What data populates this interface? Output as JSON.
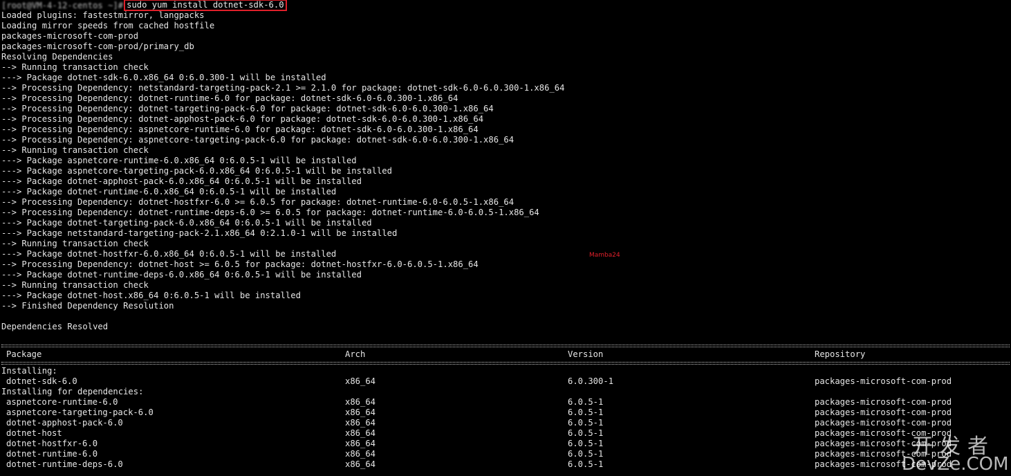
{
  "prompt": {
    "user_host": "[root@VM-4-12-centos ~]#",
    "command": "sudo yum install dotnet-sdk-6.0"
  },
  "output_lines": [
    "Loaded plugins: fastestmirror, langpacks",
    "Loading mirror speeds from cached hostfile",
    "packages-microsoft-com-prod",
    "packages-microsoft-com-prod/primary_db",
    "Resolving Dependencies",
    "--> Running transaction check",
    "---> Package dotnet-sdk-6.0.x86_64 0:6.0.300-1 will be installed",
    "--> Processing Dependency: netstandard-targeting-pack-2.1 >= 2.1.0 for package: dotnet-sdk-6.0-6.0.300-1.x86_64",
    "--> Processing Dependency: dotnet-runtime-6.0 for package: dotnet-sdk-6.0-6.0.300-1.x86_64",
    "--> Processing Dependency: dotnet-targeting-pack-6.0 for package: dotnet-sdk-6.0-6.0.300-1.x86_64",
    "--> Processing Dependency: dotnet-apphost-pack-6.0 for package: dotnet-sdk-6.0-6.0.300-1.x86_64",
    "--> Processing Dependency: aspnetcore-runtime-6.0 for package: dotnet-sdk-6.0-6.0.300-1.x86_64",
    "--> Processing Dependency: aspnetcore-targeting-pack-6.0 for package: dotnet-sdk-6.0-6.0.300-1.x86_64",
    "--> Running transaction check",
    "---> Package aspnetcore-runtime-6.0.x86_64 0:6.0.5-1 will be installed",
    "---> Package aspnetcore-targeting-pack-6.0.x86_64 0:6.0.5-1 will be installed",
    "---> Package dotnet-apphost-pack-6.0.x86_64 0:6.0.5-1 will be installed",
    "---> Package dotnet-runtime-6.0.x86_64 0:6.0.5-1 will be installed",
    "--> Processing Dependency: dotnet-hostfxr-6.0 >= 6.0.5 for package: dotnet-runtime-6.0-6.0.5-1.x86_64",
    "--> Processing Dependency: dotnet-runtime-deps-6.0 >= 6.0.5 for package: dotnet-runtime-6.0-6.0.5-1.x86_64",
    "---> Package dotnet-targeting-pack-6.0.x86_64 0:6.0.5-1 will be installed",
    "---> Package netstandard-targeting-pack-2.1.x86_64 0:2.1.0-1 will be installed",
    "--> Running transaction check",
    "---> Package dotnet-hostfxr-6.0.x86_64 0:6.0.5-1 will be installed",
    "--> Processing Dependency: dotnet-host >= 6.0.5 for package: dotnet-hostfxr-6.0-6.0.5-1.x86_64",
    "---> Package dotnet-runtime-deps-6.0.x86_64 0:6.0.5-1 will be installed",
    "--> Running transaction check",
    "---> Package dotnet-host.x86_64 0:6.0.5-1 will be installed",
    "--> Finished Dependency Resolution",
    "",
    "Dependencies Resolved",
    ""
  ],
  "table": {
    "headers": {
      "package": "Package",
      "arch": "Arch",
      "version": "Version",
      "repository": "Repository"
    },
    "installing_label": "Installing:",
    "installing": [
      {
        "package": "dotnet-sdk-6.0",
        "arch": "x86_64",
        "version": "6.0.300-1",
        "repository": "packages-microsoft-com-prod"
      }
    ],
    "deps_label": "Installing for dependencies:",
    "deps": [
      {
        "package": "aspnetcore-runtime-6.0",
        "arch": "x86_64",
        "version": "6.0.5-1",
        "repository": "packages-microsoft-com-prod"
      },
      {
        "package": "aspnetcore-targeting-pack-6.0",
        "arch": "x86_64",
        "version": "6.0.5-1",
        "repository": "packages-microsoft-com-prod"
      },
      {
        "package": "dotnet-apphost-pack-6.0",
        "arch": "x86_64",
        "version": "6.0.5-1",
        "repository": "packages-microsoft-com-prod"
      },
      {
        "package": "dotnet-host",
        "arch": "x86_64",
        "version": "6.0.5-1",
        "repository": "packages-microsoft-com-prod"
      },
      {
        "package": "dotnet-hostfxr-6.0",
        "arch": "x86_64",
        "version": "6.0.5-1",
        "repository": "packages-microsoft-com-prod"
      },
      {
        "package": "dotnet-runtime-6.0",
        "arch": "x86_64",
        "version": "6.0.5-1",
        "repository": "packages-microsoft-com-prod"
      },
      {
        "package": "dotnet-runtime-deps-6.0",
        "arch": "x86_64",
        "version": "6.0.5-1",
        "repository": "packages-microsoft-com-prod"
      }
    ]
  },
  "watermark": "Mamba24",
  "site_logo": {
    "cn": "开发者",
    "en": "DevZe.COM"
  },
  "colors": {
    "background": "#000000",
    "text": "#e6e6e6",
    "highlight": "#e0202a"
  }
}
